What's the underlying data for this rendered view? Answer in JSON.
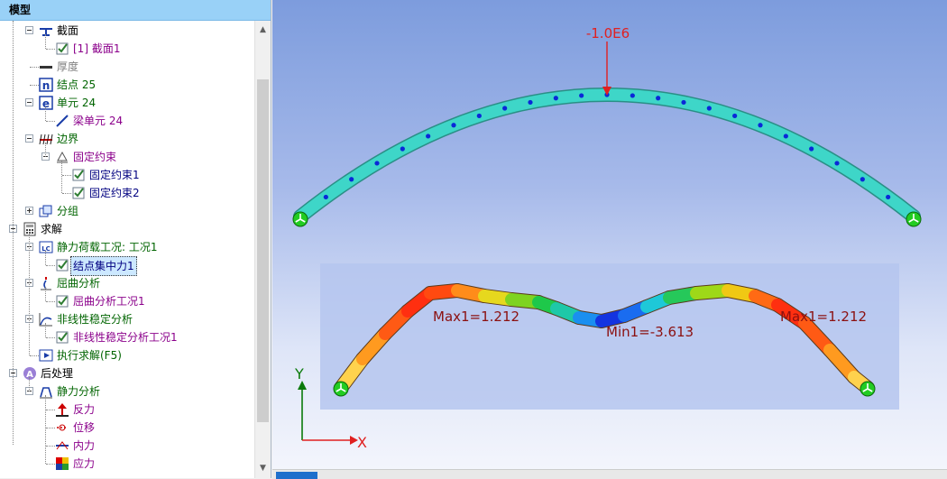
{
  "panel": {
    "title": "模型"
  },
  "tree": [
    {
      "label": "截面",
      "level": 1,
      "expander": "minus",
      "icon": "section",
      "color": "#000"
    },
    {
      "label": "[1] 截面1",
      "level": 2,
      "icon": "check",
      "color": "#8b008b"
    },
    {
      "label": "厚度",
      "level": 1,
      "icon": "thickness",
      "color": "#808080"
    },
    {
      "label": "结点 25",
      "level": 1,
      "icon": "node-n",
      "color": "#006400"
    },
    {
      "label": "单元 24",
      "level": 1,
      "expander": "minus",
      "icon": "element-e",
      "color": "#006400"
    },
    {
      "label": "梁单元 24",
      "level": 2,
      "icon": "beam",
      "color": "#8b008b"
    },
    {
      "label": "边界",
      "level": 1,
      "expander": "minus",
      "icon": "boundary",
      "color": "#006400"
    },
    {
      "label": "固定约束",
      "level": 2,
      "expander": "minus",
      "icon": "fixed",
      "color": "#8b008b"
    },
    {
      "label": "固定约束1",
      "level": 3,
      "icon": "check",
      "color": "#000080"
    },
    {
      "label": "固定约束2",
      "level": 3,
      "icon": "check",
      "color": "#000080"
    },
    {
      "label": "分组",
      "level": 1,
      "expander": "plus",
      "icon": "group",
      "color": "#006400"
    },
    {
      "label": "求解",
      "level": 0,
      "expander": "minus",
      "icon": "solve",
      "color": "#000"
    },
    {
      "label": "静力荷载工况: 工况1",
      "level": 1,
      "expander": "minus",
      "icon": "lc",
      "color": "#006400"
    },
    {
      "label": "结点集中力1",
      "level": 2,
      "icon": "check",
      "color": "#000080",
      "selected": true
    },
    {
      "label": "屈曲分析",
      "level": 1,
      "expander": "minus",
      "icon": "buckling",
      "color": "#006400"
    },
    {
      "label": "屈曲分析工况1",
      "level": 2,
      "icon": "check",
      "color": "#8b008b"
    },
    {
      "label": "非线性稳定分析",
      "level": 1,
      "expander": "minus",
      "icon": "nonlinear",
      "color": "#006400"
    },
    {
      "label": "非线性稳定分析工况1",
      "level": 2,
      "icon": "check",
      "color": "#8b008b"
    },
    {
      "label": "执行求解(F5)",
      "level": 1,
      "icon": "run",
      "color": "#006400"
    },
    {
      "label": "后处理",
      "level": 0,
      "expander": "minus",
      "icon": "post",
      "color": "#000"
    },
    {
      "label": "静力分析",
      "level": 1,
      "expander": "minus",
      "icon": "static",
      "color": "#006400"
    },
    {
      "label": "反力",
      "level": 2,
      "icon": "reaction",
      "color": "#8b008b"
    },
    {
      "label": "位移",
      "level": 2,
      "icon": "displacement",
      "color": "#8b008b"
    },
    {
      "label": "内力",
      "level": 2,
      "icon": "internal-force",
      "color": "#8b008b"
    },
    {
      "label": "应力",
      "level": 2,
      "icon": "stress",
      "color": "#8b008b"
    }
  ],
  "viewport": {
    "load_label": "-1.0E6",
    "max_left": "Max1=1.212",
    "min_center": "Min1=-3.613",
    "max_right": "Max1=1.212",
    "axis_y": "Y",
    "axis_x": "X",
    "model_color": "#3ed6c8",
    "node_color": "#0a28d8",
    "load_color": "#e02020",
    "support_color": "#22cc22"
  }
}
